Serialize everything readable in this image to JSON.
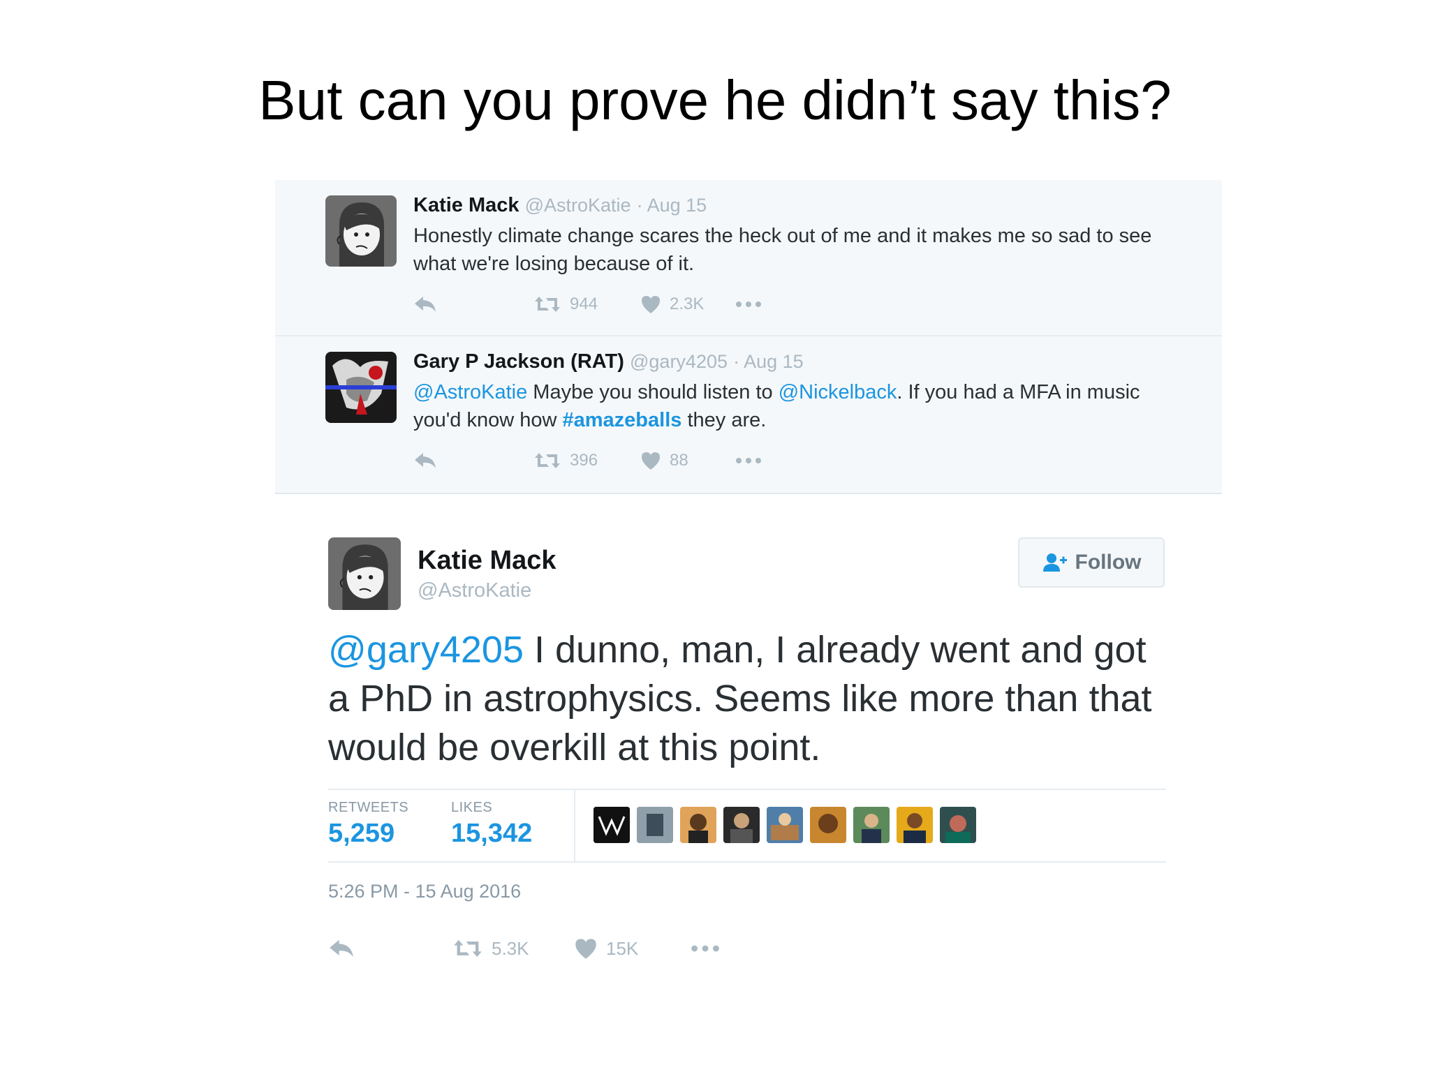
{
  "slide": {
    "title": "But can you prove he didn’t say this?"
  },
  "conversation": [
    {
      "name": "Katie Mack",
      "handle": "@AstroKatie",
      "date": "· Aug 15",
      "text": "Honestly climate change scares the heck out of me and it makes me so sad to see what we're losing because of it.",
      "retweets": "944",
      "likes": "2.3K"
    },
    {
      "name": "Gary P Jackson (RAT)",
      "handle": "@gary4205",
      "date": "· Aug 15",
      "mention1": "@AstroKatie",
      "text_a": " Maybe you should listen to ",
      "mention2": "@Nickelback",
      "text_b": ". If you had a MFA in music you'd know how ",
      "hashtag": "#amazeballs",
      "text_c": " they are.",
      "retweets": "396",
      "likes": "88"
    }
  ],
  "main_tweet": {
    "name": "Katie Mack",
    "handle": "@AstroKatie",
    "follow_label": "Follow",
    "mention": "@gary4205",
    "text": " I dunno, man, I already went and got a PhD in astrophysics. Seems like more than that would be overkill at this point.",
    "retweets_label": "RETWEETS",
    "retweets_value": "5,259",
    "likes_label": "LIKES",
    "likes_value": "15,342",
    "liker_avatar_count": 9,
    "timestamp": "5:26 PM - 15 Aug 2016",
    "action_retweets": "5.3K",
    "action_likes": "15K"
  },
  "colors": {
    "link": "#1b95e0",
    "muted": "#aab8c2",
    "text": "#292f33",
    "convo_bg": "#f5f8fa"
  },
  "icons": [
    "reply-icon",
    "retweet-icon",
    "heart-icon",
    "more-icon",
    "follow-person-icon"
  ]
}
